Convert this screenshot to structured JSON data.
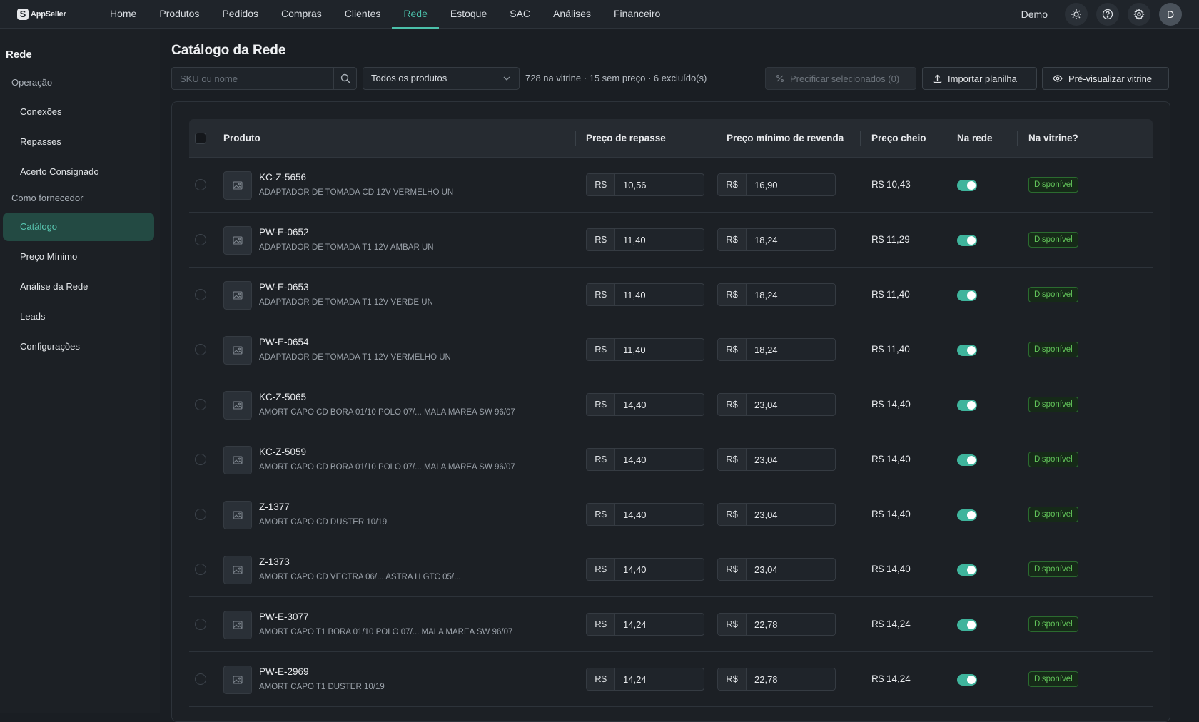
{
  "brand": {
    "name": "AppSeller",
    "mark": "S"
  },
  "nav": {
    "items": [
      "Home",
      "Produtos",
      "Pedidos",
      "Compras",
      "Clientes",
      "Rede",
      "Estoque",
      "SAC",
      "Análises",
      "Financeiro"
    ],
    "active": "Rede"
  },
  "user": {
    "name": "Demo",
    "initial": "D"
  },
  "sidebar": {
    "title": "Rede",
    "group_operacao": "Operação",
    "conexoes": "Conexões",
    "repasses": "Repasses",
    "acerto": "Acerto Consignado",
    "group_fornecedor": "Como fornecedor",
    "catalogo": "Catálogo",
    "preco_minimo": "Preço Mínimo",
    "analise": "Análise da Rede",
    "leads": "Leads",
    "configuracoes": "Configurações",
    "active": "Catálogo"
  },
  "page": {
    "title": "Catálogo da Rede",
    "search_placeholder": "SKU ou nome",
    "filter_value": "Todos os produtos",
    "summary": "728 na vitrine · 15 sem preço · 6 excluído(s)",
    "btn_precificar": "Precificar selecionados (0)",
    "btn_importar": "Importar planilha",
    "btn_previsualizar": "Pré-visualizar vitrine"
  },
  "table": {
    "headers": {
      "produto": "Produto",
      "repasse": "Preço de repasse",
      "minimo": "Preço mínimo de revenda",
      "cheio": "Preço cheio",
      "rede": "Na rede",
      "vitrine": "Na vitrine?"
    },
    "currency": "R$",
    "rows": [
      {
        "sku": "KC-Z-5656",
        "desc": "ADAPTADOR DE TOMADA CD 12V VERMELHO UN",
        "repasse": "10,56",
        "minimo": "16,90",
        "cheio": "R$ 10,43",
        "na_rede": true,
        "status": "Disponível"
      },
      {
        "sku": "PW-E-0652",
        "desc": "ADAPTADOR DE TOMADA T1 12V AMBAR UN",
        "repasse": "11,40",
        "minimo": "18,24",
        "cheio": "R$ 11,29",
        "na_rede": true,
        "status": "Disponível"
      },
      {
        "sku": "PW-E-0653",
        "desc": "ADAPTADOR DE TOMADA T1 12V VERDE UN",
        "repasse": "11,40",
        "minimo": "18,24",
        "cheio": "R$ 11,40",
        "na_rede": true,
        "status": "Disponível"
      },
      {
        "sku": "PW-E-0654",
        "desc": "ADAPTADOR DE TOMADA T1 12V VERMELHO UN",
        "repasse": "11,40",
        "minimo": "18,24",
        "cheio": "R$ 11,40",
        "na_rede": true,
        "status": "Disponível"
      },
      {
        "sku": "KC-Z-5065",
        "desc": "AMORT CAPO CD BORA 01/10 POLO 07/... MALA MAREA SW 96/07",
        "repasse": "14,40",
        "minimo": "23,04",
        "cheio": "R$ 14,40",
        "na_rede": true,
        "status": "Disponível"
      },
      {
        "sku": "KC-Z-5059",
        "desc": "AMORT CAPO CD BORA 01/10 POLO 07/... MALA MAREA SW 96/07",
        "repasse": "14,40",
        "minimo": "23,04",
        "cheio": "R$ 14,40",
        "na_rede": true,
        "status": "Disponível"
      },
      {
        "sku": "Z-1377",
        "desc": "AMORT CAPO CD DUSTER 10/19",
        "repasse": "14,40",
        "minimo": "23,04",
        "cheio": "R$ 14,40",
        "na_rede": true,
        "status": "Disponível"
      },
      {
        "sku": "Z-1373",
        "desc": "AMORT CAPO CD VECTRA 06/... ASTRA H GTC 05/...",
        "repasse": "14,40",
        "minimo": "23,04",
        "cheio": "R$ 14,40",
        "na_rede": true,
        "status": "Disponível"
      },
      {
        "sku": "PW-E-3077",
        "desc": "AMORT CAPO T1 BORA 01/10 POLO 07/... MALA MAREA SW 96/07",
        "repasse": "14,24",
        "minimo": "22,78",
        "cheio": "R$ 14,24",
        "na_rede": true,
        "status": "Disponível"
      },
      {
        "sku": "PW-E-2969",
        "desc": "AMORT CAPO T1 DUSTER 10/19",
        "repasse": "14,24",
        "minimo": "22,78",
        "cheio": "R$ 14,24",
        "na_rede": true,
        "status": "Disponível"
      }
    ]
  },
  "colors": {
    "accent": "#4bc0aa",
    "toggle": "#3fb49c",
    "badge_text": "#62c45a",
    "background": "#1a1e23"
  },
  "icons": [
    "sun-icon",
    "help-icon",
    "gear-icon",
    "search-icon",
    "chevron-down-icon",
    "percent-icon",
    "upload-icon",
    "eye-icon",
    "image-placeholder-icon"
  ]
}
